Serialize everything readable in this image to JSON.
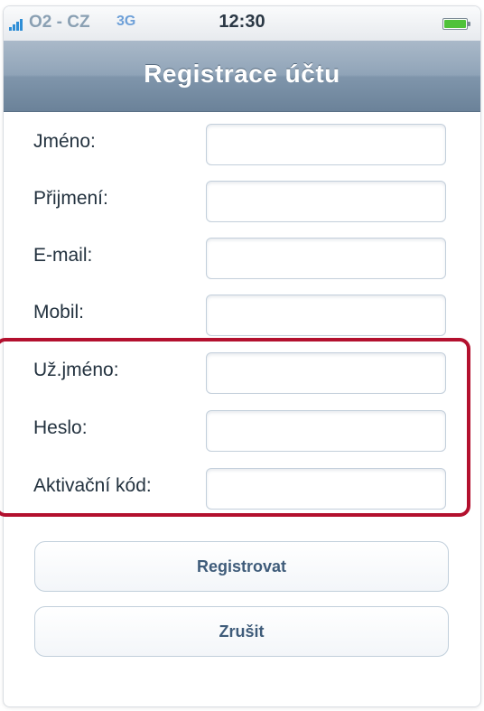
{
  "status_bar": {
    "carrier": "O2 - CZ",
    "network": "3G",
    "time": "12:30",
    "battery_icon": "battery-full-icon",
    "signal_icon": "signal-bars-icon"
  },
  "nav": {
    "title": "Registrace účtu"
  },
  "form": {
    "fields": [
      {
        "label": "Jméno:",
        "value": "",
        "placeholder": ""
      },
      {
        "label": "Přijmení:",
        "value": "",
        "placeholder": ""
      },
      {
        "label": "E-mail:",
        "value": "",
        "placeholder": ""
      },
      {
        "label": "Mobil:",
        "value": "",
        "placeholder": ""
      },
      {
        "label": "Už.jméno:",
        "value": "",
        "placeholder": ""
      },
      {
        "label": "Heslo:",
        "value": "",
        "placeholder": ""
      },
      {
        "label": "Aktivační kód:",
        "value": "",
        "placeholder": ""
      }
    ]
  },
  "buttons": {
    "register": "Registrovat",
    "cancel": "Zrušit"
  },
  "colors": {
    "highlight_frame": "#b3102e",
    "nav_bar": "#8ea2b6",
    "button_text": "#3f5c7a",
    "battery": "#4fc23a",
    "signal": "#2f8ed6"
  }
}
